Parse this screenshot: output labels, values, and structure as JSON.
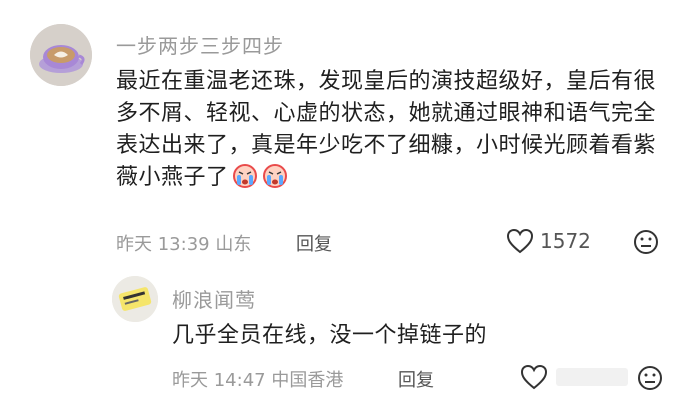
{
  "comment": {
    "username": "一步两步三步四步",
    "text": "最近在重温老还珠，发现皇后的演技超级好，皇后有很多不屑、轻视、心虚的状态，她就通过眼神和语气完全表达出来了，真是年少吃不了细糠，小时候光顾着看紫薇小燕子了",
    "time": "昨天 13:39",
    "location": "山东",
    "reply_label": "回复",
    "like_count": "1572",
    "emojis": [
      "crying-face-icon",
      "crying-face-icon"
    ]
  },
  "reply": {
    "username": "柳浪闻莺",
    "text": "几乎全员在线，没一个掉链子的",
    "time": "昨天 14:47",
    "location": "中国香港",
    "reply_label": "回复"
  },
  "colors": {
    "secondary_text": "#9a9a9a",
    "primary_text": "#1f1f1f",
    "emoji_red": "#e94b4b"
  }
}
